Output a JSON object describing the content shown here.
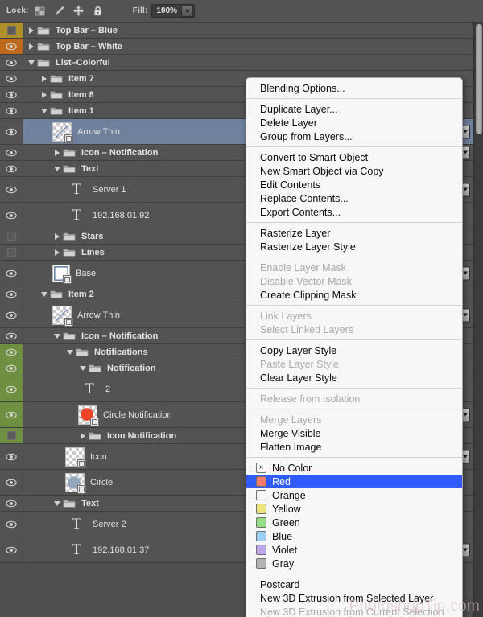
{
  "toolbar": {
    "lock_label": "Lock:",
    "lock_icons": [
      "transparent-pixels-icon",
      "image-pixels-icon",
      "position-icon",
      "lock-all-icon"
    ],
    "fill_label": "Fill:",
    "fill_value": "100%"
  },
  "colors": {
    "panel_bg": "#4f4f4f",
    "row_bg": "#535353",
    "selected_row": "#6f819d",
    "label_yellow": "#b08f2a",
    "label_orange": "#bd6a1c",
    "label_green": "#6f9040",
    "menu_bg": "#f7f7f7",
    "menu_highlight": "#2f5bff"
  },
  "layers": [
    {
      "name": "Top Bar – Blue",
      "type": "folder",
      "indent": 1,
      "visible": false,
      "label": "yellow",
      "expanded": false,
      "arrow": false
    },
    {
      "name": "Top Bar – White",
      "type": "folder",
      "indent": 1,
      "visible": true,
      "label": "orange",
      "expanded": false,
      "arrow": false
    },
    {
      "name": "List–Colorful",
      "type": "folder",
      "indent": 1,
      "visible": true,
      "label": "none",
      "expanded": true,
      "arrow": false
    },
    {
      "name": "Item 7",
      "type": "folder",
      "indent": 2,
      "visible": true,
      "label": "none",
      "expanded": false,
      "arrow": false
    },
    {
      "name": "Item 8",
      "type": "folder",
      "indent": 2,
      "visible": true,
      "label": "none",
      "expanded": false,
      "arrow": false
    },
    {
      "name": "Item 1",
      "type": "folder",
      "indent": 2,
      "visible": true,
      "label": "none",
      "expanded": true,
      "arrow": false
    },
    {
      "name": "Arrow Thin",
      "type": "smart",
      "indent": 3,
      "visible": true,
      "label": "none",
      "selected": true,
      "arrow": true
    },
    {
      "name": "Icon – Notification",
      "type": "folder",
      "indent": 3,
      "visible": true,
      "label": "none",
      "expanded": false,
      "arrow": true
    },
    {
      "name": "Text",
      "type": "folder",
      "indent": 3,
      "visible": true,
      "label": "none",
      "expanded": true,
      "arrow": false
    },
    {
      "name": "Server 1",
      "type": "text",
      "indent": 4,
      "visible": true,
      "label": "none",
      "arrow": true
    },
    {
      "name": "192.168.01.92",
      "type": "text",
      "indent": 4,
      "visible": true,
      "label": "none",
      "arrow": false
    },
    {
      "name": "Stars",
      "type": "folder",
      "indent": 3,
      "visible": false,
      "label": "none",
      "expanded": false,
      "arrow": false
    },
    {
      "name": "Lines",
      "type": "folder",
      "indent": 3,
      "visible": false,
      "label": "none",
      "expanded": false,
      "arrow": false
    },
    {
      "name": "Base",
      "type": "shape",
      "indent": 3,
      "visible": true,
      "label": "none",
      "arrow": true
    },
    {
      "name": "Item 2",
      "type": "folder",
      "indent": 2,
      "visible": true,
      "label": "none",
      "expanded": true,
      "arrow": false
    },
    {
      "name": "Arrow Thin",
      "type": "smart",
      "indent": 3,
      "visible": true,
      "label": "none",
      "arrow": true
    },
    {
      "name": "Icon – Notification",
      "type": "folder",
      "indent": 3,
      "visible": true,
      "label": "none",
      "expanded": true,
      "arrow": false
    },
    {
      "name": "Notifications",
      "type": "folder",
      "indent": 4,
      "visible": true,
      "label": "green",
      "expanded": true,
      "arrow": false
    },
    {
      "name": "Notification",
      "type": "folder",
      "indent": 5,
      "visible": true,
      "label": "green",
      "expanded": true,
      "arrow": false
    },
    {
      "name": "2",
      "type": "text",
      "indent": 5,
      "visible": true,
      "label": "green",
      "arrow": false
    },
    {
      "name": "Circle Notification",
      "type": "raster-red",
      "indent": 5,
      "visible": true,
      "label": "green",
      "arrow": true
    },
    {
      "name": "Icon Notification",
      "type": "folder",
      "indent": 5,
      "visible": false,
      "label": "green",
      "expanded": false,
      "arrow": false
    },
    {
      "name": "Icon",
      "type": "raster",
      "indent": 4,
      "visible": true,
      "label": "none",
      "arrow": true
    },
    {
      "name": "Circle",
      "type": "raster-blue",
      "indent": 4,
      "visible": true,
      "label": "none",
      "arrow": false
    },
    {
      "name": "Text",
      "type": "folder",
      "indent": 3,
      "visible": true,
      "label": "none",
      "expanded": true,
      "arrow": false
    },
    {
      "name": "Server 2",
      "type": "text",
      "indent": 4,
      "visible": true,
      "label": "none",
      "arrow": false
    },
    {
      "name": "192.168.01.37",
      "type": "text",
      "indent": 4,
      "visible": true,
      "label": "none",
      "arrow": true
    }
  ],
  "context_menu": {
    "groups": [
      {
        "items": [
          {
            "label": "Blending Options...",
            "state": "enabled"
          }
        ]
      },
      {
        "items": [
          {
            "label": "Duplicate Layer...",
            "state": "enabled"
          },
          {
            "label": "Delete Layer",
            "state": "enabled"
          },
          {
            "label": "Group from Layers...",
            "state": "enabled"
          }
        ]
      },
      {
        "items": [
          {
            "label": "Convert to Smart Object",
            "state": "enabled"
          },
          {
            "label": "New Smart Object via Copy",
            "state": "enabled"
          },
          {
            "label": "Edit Contents",
            "state": "enabled"
          },
          {
            "label": "Replace Contents...",
            "state": "enabled"
          },
          {
            "label": "Export Contents...",
            "state": "enabled"
          }
        ]
      },
      {
        "items": [
          {
            "label": "Rasterize Layer",
            "state": "enabled"
          },
          {
            "label": "Rasterize Layer Style",
            "state": "enabled"
          }
        ]
      },
      {
        "items": [
          {
            "label": "Enable Layer Mask",
            "state": "disabled"
          },
          {
            "label": "Disable Vector Mask",
            "state": "disabled"
          },
          {
            "label": "Create Clipping Mask",
            "state": "enabled"
          }
        ]
      },
      {
        "items": [
          {
            "label": "Link Layers",
            "state": "disabled"
          },
          {
            "label": "Select Linked Layers",
            "state": "disabled"
          }
        ]
      },
      {
        "items": [
          {
            "label": "Copy Layer Style",
            "state": "enabled"
          },
          {
            "label": "Paste Layer Style",
            "state": "disabled"
          },
          {
            "label": "Clear Layer Style",
            "state": "enabled"
          }
        ]
      },
      {
        "items": [
          {
            "label": "Release from Isolation",
            "state": "disabled"
          }
        ]
      },
      {
        "items": [
          {
            "label": "Merge Layers",
            "state": "disabled"
          },
          {
            "label": "Merge Visible",
            "state": "enabled"
          },
          {
            "label": "Flatten Image",
            "state": "enabled"
          }
        ]
      }
    ],
    "color_items": [
      {
        "label": "No Color",
        "swatch": "none",
        "selected": false
      },
      {
        "label": "Red",
        "swatch": "#f47b6e",
        "selected": true
      },
      {
        "label": "Orange",
        "swatch": "#f5a council",
        "selected": false
      },
      {
        "label": "Yellow",
        "swatch": "#ece37a",
        "selected": false
      },
      {
        "label": "Green",
        "swatch": "#95de86",
        "selected": false
      },
      {
        "label": "Blue",
        "swatch": "#9bd0f5",
        "selected": false
      },
      {
        "label": "Violet",
        "swatch": "#bda6ea",
        "selected": false
      },
      {
        "label": "Gray",
        "swatch": "#b4b4b4",
        "selected": false
      }
    ],
    "bottom_items": [
      {
        "label": "Postcard",
        "state": "enabled"
      },
      {
        "label": "New 3D Extrusion from Selected Layer",
        "state": "enabled"
      },
      {
        "label": "New 3D Extrusion from Current Selection",
        "state": "disabled"
      }
    ],
    "no_color_glyph": "×"
  },
  "watermark": "PhotoshopTip.com"
}
